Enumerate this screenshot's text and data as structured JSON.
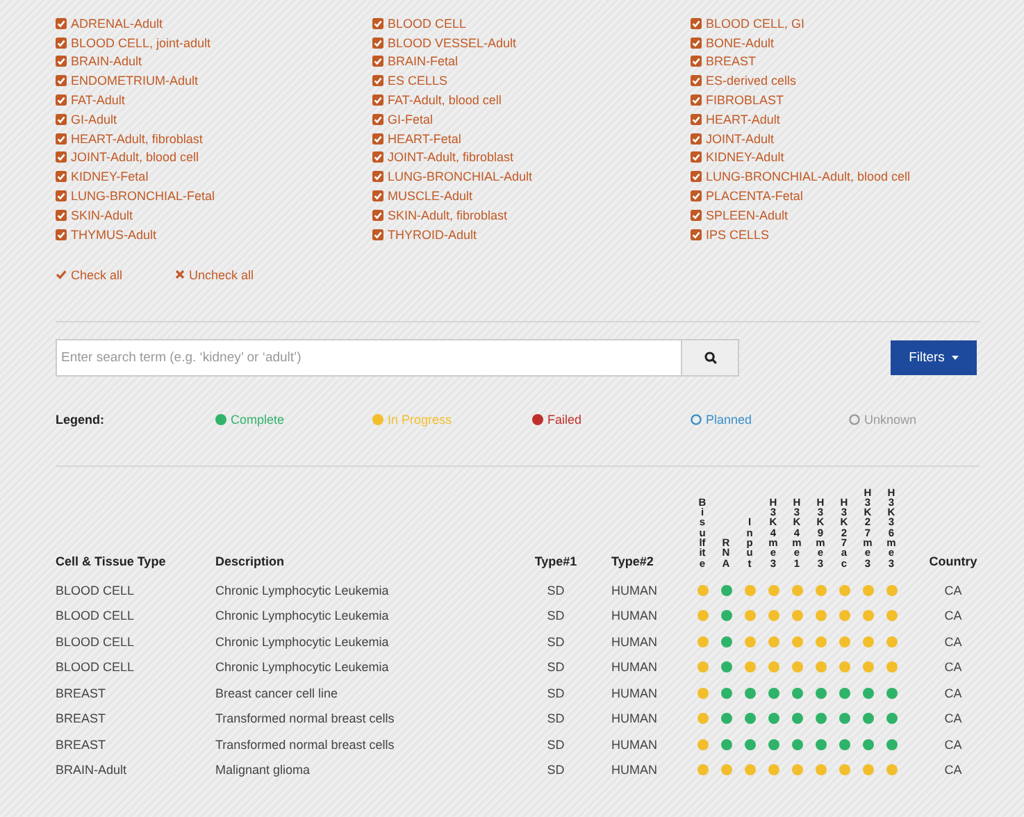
{
  "tissue_filters": [
    {
      "label": "ADRENAL-Adult",
      "checked": true
    },
    {
      "label": "BLOOD CELL",
      "checked": true
    },
    {
      "label": "BLOOD CELL, GI",
      "checked": true
    },
    {
      "label": "BLOOD CELL, joint-adult",
      "checked": true
    },
    {
      "label": "BLOOD VESSEL-Adult",
      "checked": true
    },
    {
      "label": "BONE-Adult",
      "checked": true
    },
    {
      "label": "BRAIN-Adult",
      "checked": true
    },
    {
      "label": "BRAIN-Fetal",
      "checked": true
    },
    {
      "label": "BREAST",
      "checked": true
    },
    {
      "label": "ENDOMETRIUM-Adult",
      "checked": true
    },
    {
      "label": "ES CELLS",
      "checked": true
    },
    {
      "label": "ES-derived cells",
      "checked": true
    },
    {
      "label": "FAT-Adult",
      "checked": true
    },
    {
      "label": "FAT-Adult, blood cell",
      "checked": true
    },
    {
      "label": "FIBROBLAST",
      "checked": true
    },
    {
      "label": "GI-Adult",
      "checked": true
    },
    {
      "label": "GI-Fetal",
      "checked": true
    },
    {
      "label": "HEART-Adult",
      "checked": true
    },
    {
      "label": "HEART-Adult, fibroblast",
      "checked": true
    },
    {
      "label": "HEART-Fetal",
      "checked": true
    },
    {
      "label": "JOINT-Adult",
      "checked": true
    },
    {
      "label": "JOINT-Adult, blood cell",
      "checked": true
    },
    {
      "label": "JOINT-Adult, fibroblast",
      "checked": true
    },
    {
      "label": "KIDNEY-Adult",
      "checked": true
    },
    {
      "label": "KIDNEY-Fetal",
      "checked": true
    },
    {
      "label": "LUNG-BRONCHIAL-Adult",
      "checked": true
    },
    {
      "label": "LUNG-BRONCHIAL-Adult, blood cell",
      "checked": true
    },
    {
      "label": "LUNG-BRONCHIAL-Fetal",
      "checked": true
    },
    {
      "label": "MUSCLE-Adult",
      "checked": true
    },
    {
      "label": "PLACENTA-Fetal",
      "checked": true
    },
    {
      "label": "SKIN-Adult",
      "checked": true
    },
    {
      "label": "SKIN-Adult, fibroblast",
      "checked": true
    },
    {
      "label": "SPLEEN-Adult",
      "checked": true
    },
    {
      "label": "THYMUS-Adult",
      "checked": true
    },
    {
      "label": "THYROID-Adult",
      "checked": true
    },
    {
      "label": "IPS CELLS",
      "checked": true
    }
  ],
  "bulk_actions": {
    "check_all": "Check all",
    "uncheck_all": "Uncheck all"
  },
  "search": {
    "placeholder": "Enter search term (e.g. ‘kidney’ or ‘adult’)"
  },
  "filters_button": "Filters",
  "legend": {
    "label": "Legend:",
    "items": [
      {
        "kind": "complete",
        "label": "Complete",
        "color": "#2fb36a"
      },
      {
        "kind": "in_progress",
        "label": "In Progress",
        "color": "#f2be2c"
      },
      {
        "kind": "failed",
        "label": "Failed",
        "color": "#c0302b"
      },
      {
        "kind": "planned",
        "label": "Planned",
        "color": "#3a8fc8"
      },
      {
        "kind": "unknown",
        "label": "Unknown",
        "color": "#9a9a9a"
      }
    ]
  },
  "table": {
    "columns": [
      "Cell & Tissue Type",
      "Description",
      "Type#1",
      "Type#2"
    ],
    "assay_columns": [
      "Bisulfite",
      "RNA",
      "Input",
      "H3K4me3",
      "H3K4me1",
      "H3K9me3",
      "H3K27ac",
      "H3K27me3",
      "H3K36me3"
    ],
    "last_column": "Country",
    "rows": [
      {
        "cells": [
          "BLOOD CELL",
          "Chronic Lymphocytic Leukemia",
          "SD",
          "HUMAN"
        ],
        "assays": [
          {
            "color": "#f2be2c"
          },
          {
            "color": "#2fb36a"
          },
          {
            "color": "#f2be2c"
          },
          {
            "color": "#f2be2c"
          },
          {
            "color": "#f2be2c"
          },
          {
            "color": "#f2be2c"
          },
          {
            "color": "#f2be2c"
          },
          {
            "color": "#f2be2c"
          },
          {
            "color": "#f2be2c"
          }
        ],
        "country": "CA"
      },
      {
        "cells": [
          "BLOOD CELL",
          "Chronic Lymphocytic Leukemia",
          "SD",
          "HUMAN"
        ],
        "assays": [
          {
            "color": "#f2be2c"
          },
          {
            "color": "#2fb36a"
          },
          {
            "color": "#f2be2c"
          },
          {
            "color": "#f2be2c"
          },
          {
            "color": "#f2be2c"
          },
          {
            "color": "#f2be2c"
          },
          {
            "color": "#f2be2c"
          },
          {
            "color": "#f2be2c"
          },
          {
            "color": "#f2be2c"
          }
        ],
        "country": "CA"
      },
      {
        "cells": [
          "BLOOD CELL",
          "Chronic Lymphocytic Leukemia",
          "SD",
          "HUMAN"
        ],
        "assays": [
          {
            "color": "#f2be2c"
          },
          {
            "color": "#2fb36a"
          },
          {
            "color": "#f2be2c"
          },
          {
            "color": "#f2be2c"
          },
          {
            "color": "#f2be2c"
          },
          {
            "color": "#f2be2c"
          },
          {
            "color": "#f2be2c"
          },
          {
            "color": "#f2be2c"
          },
          {
            "color": "#f2be2c"
          }
        ],
        "country": "CA"
      },
      {
        "cells": [
          "BLOOD CELL",
          "Chronic Lymphocytic Leukemia",
          "SD",
          "HUMAN"
        ],
        "assays": [
          {
            "color": "#f2be2c"
          },
          {
            "color": "#2fb36a"
          },
          {
            "color": "#f2be2c"
          },
          {
            "color": "#f2be2c"
          },
          {
            "color": "#f2be2c"
          },
          {
            "color": "#f2be2c"
          },
          {
            "color": "#f2be2c"
          },
          {
            "color": "#f2be2c"
          },
          {
            "color": "#f2be2c"
          }
        ],
        "country": "CA"
      },
      {
        "cells": [
          "BREAST",
          "Breast cancer cell line",
          "SD",
          "HUMAN"
        ],
        "assays": [
          {
            "color": "#f2be2c"
          },
          {
            "color": "#2fb36a"
          },
          {
            "color": "#2fb36a"
          },
          {
            "color": "#2fb36a"
          },
          {
            "color": "#2fb36a"
          },
          {
            "color": "#2fb36a"
          },
          {
            "color": "#2fb36a"
          },
          {
            "color": "#2fb36a"
          },
          {
            "color": "#2fb36a"
          }
        ],
        "country": "CA"
      },
      {
        "cells": [
          "BREAST",
          "Transformed normal breast cells",
          "SD",
          "HUMAN"
        ],
        "assays": [
          {
            "color": "#f2be2c"
          },
          {
            "color": "#2fb36a"
          },
          {
            "color": "#2fb36a"
          },
          {
            "color": "#2fb36a"
          },
          {
            "color": "#2fb36a"
          },
          {
            "color": "#2fb36a"
          },
          {
            "color": "#2fb36a"
          },
          {
            "color": "#2fb36a"
          },
          {
            "color": "#2fb36a"
          }
        ],
        "country": "CA"
      },
      {
        "cells": [
          "BREAST",
          "Transformed normal breast cells",
          "SD",
          "HUMAN"
        ],
        "assays": [
          {
            "color": "#f2be2c"
          },
          {
            "color": "#2fb36a"
          },
          {
            "color": "#2fb36a"
          },
          {
            "color": "#2fb36a"
          },
          {
            "color": "#2fb36a"
          },
          {
            "color": "#2fb36a"
          },
          {
            "color": "#2fb36a"
          },
          {
            "color": "#2fb36a"
          },
          {
            "color": "#2fb36a"
          }
        ],
        "country": "CA"
      },
      {
        "cells": [
          "BRAIN-Adult",
          "Malignant glioma",
          "SD",
          "HUMAN"
        ],
        "assays": [
          {
            "color": "#f2be2c"
          },
          {
            "color": "#f2be2c"
          },
          {
            "color": "#f2be2c"
          },
          {
            "color": "#f2be2c"
          },
          {
            "color": "#f2be2c"
          },
          {
            "color": "#f2be2c"
          },
          {
            "color": "#f2be2c"
          },
          {
            "color": "#f2be2c"
          },
          {
            "color": "#f2be2c"
          }
        ],
        "country": "CA"
      }
    ]
  }
}
